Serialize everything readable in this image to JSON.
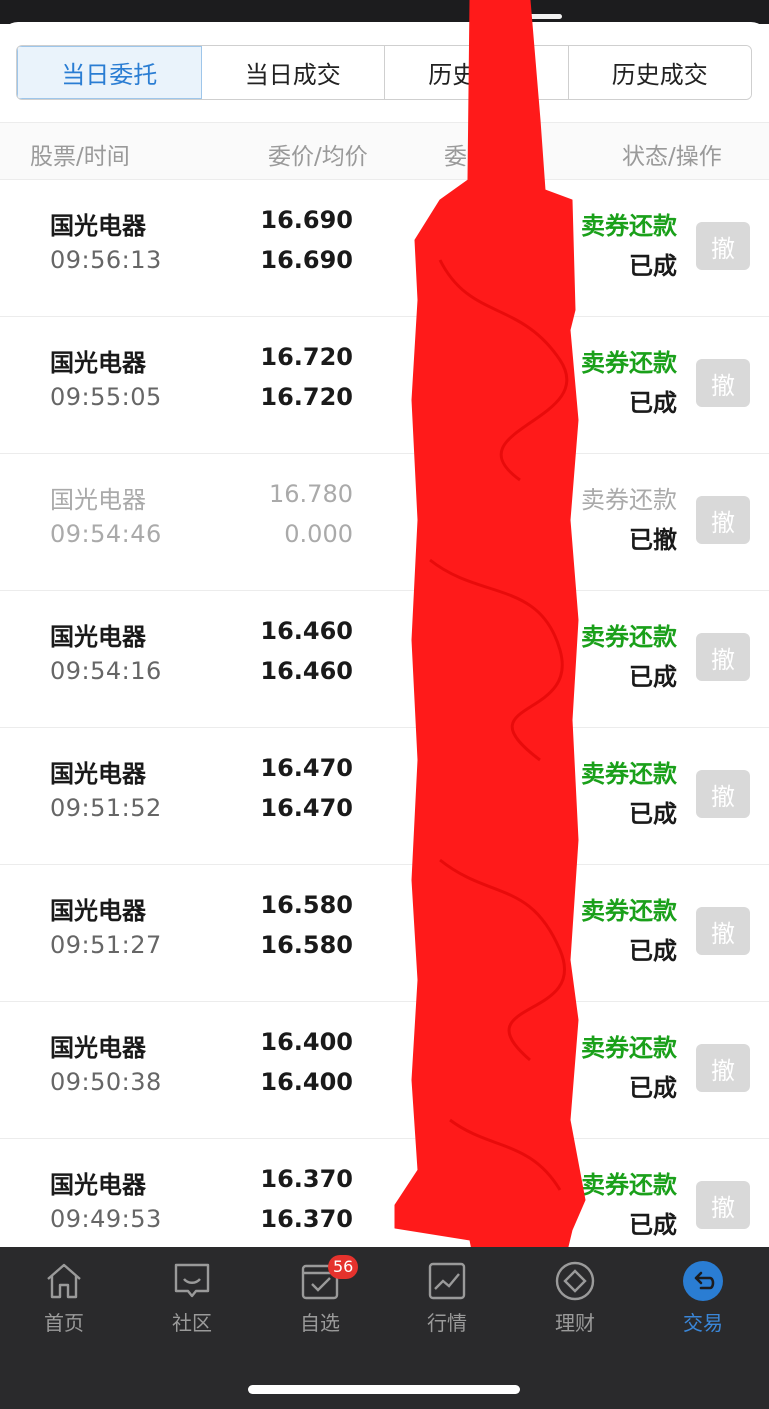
{
  "tabs": [
    "当日委托",
    "当日成交",
    "历史委托",
    "历史成交"
  ],
  "active_tab": 0,
  "columns": {
    "stock_time": "股票/时间",
    "price_avg": "委价/均价",
    "qty_filled": "委量/成交",
    "status_action": "状态/操作"
  },
  "orders": [
    {
      "name": "国光电器",
      "time": "09:56:13",
      "price": "16.690",
      "avg": "16.690",
      "type": "卖券还款",
      "status": "已成",
      "action": "撤"
    },
    {
      "name": "国光电器",
      "time": "09:55:05",
      "price": "16.720",
      "avg": "16.720",
      "type": "卖券还款",
      "status": "已成",
      "action": "撤"
    },
    {
      "name": "国光电器",
      "time": "09:54:46",
      "price": "16.780",
      "avg": "0.000",
      "type": "卖券还款",
      "status": "已撤",
      "action": "撤"
    },
    {
      "name": "国光电器",
      "time": "09:54:16",
      "price": "16.460",
      "avg": "16.460",
      "type": "卖券还款",
      "status": "已成",
      "action": "撤"
    },
    {
      "name": "国光电器",
      "time": "09:51:52",
      "price": "16.470",
      "avg": "16.470",
      "type": "卖券还款",
      "status": "已成",
      "action": "撤"
    },
    {
      "name": "国光电器",
      "time": "09:51:27",
      "price": "16.580",
      "avg": "16.580",
      "type": "卖券还款",
      "status": "已成",
      "action": "撤"
    },
    {
      "name": "国光电器",
      "time": "09:50:38",
      "price": "16.400",
      "avg": "16.400",
      "type": "卖券还款",
      "status": "已成",
      "action": "撤"
    },
    {
      "name": "国光电器",
      "time": "09:49:53",
      "price": "16.370",
      "avg": "16.370",
      "type": "卖券还款",
      "status": "已成",
      "action": "撤"
    }
  ],
  "bottom_nav": [
    {
      "label": "首页",
      "icon": "home-icon"
    },
    {
      "label": "社区",
      "icon": "chat-bubble-icon"
    },
    {
      "label": "自选",
      "icon": "checklist-icon",
      "badge": "56"
    },
    {
      "label": "行情",
      "icon": "chart-icon"
    },
    {
      "label": "理财",
      "icon": "diamond-icon"
    },
    {
      "label": "交易",
      "icon": "trade-icon",
      "active": true
    }
  ],
  "colors": {
    "accent": "#2a7dd3",
    "buy_sell_type": "#1aa01a",
    "badge": "#e5322d",
    "redaction": "#ff1a1a"
  }
}
